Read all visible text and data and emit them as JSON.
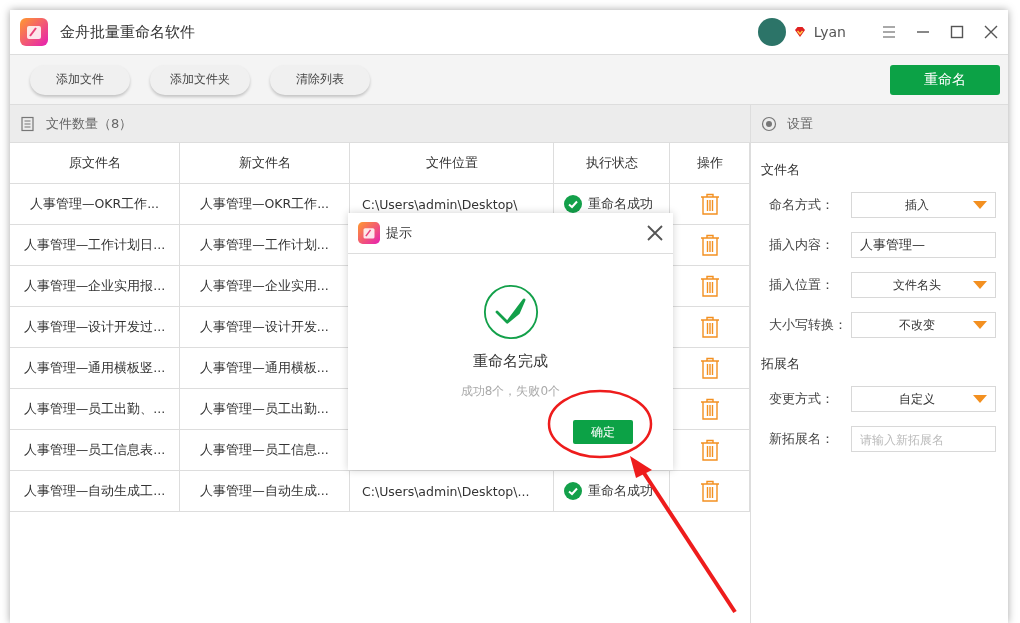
{
  "window": {
    "title": "金舟批量重命名软件",
    "user": "Lyan"
  },
  "toolbar": {
    "buttons": [
      "添加文件",
      "添加文件夹",
      "清除列表"
    ],
    "primary": "重命名"
  },
  "file_list": {
    "title": "文件数量（8）",
    "columns": [
      "原文件名",
      "新文件名",
      "文件位置",
      "执行状态",
      "操作"
    ],
    "rows": [
      {
        "original": "人事管理—OKR工作...",
        "renamed": "人事管理—OKR工作...",
        "location": "C:\\Users\\admin\\Desktop\\",
        "status": "重命名成功"
      },
      {
        "original": "人事管理—工作计划日...",
        "renamed": "人事管理—工作计划..."
      },
      {
        "original": "人事管理—企业实用报...",
        "renamed": "人事管理—企业实用..."
      },
      {
        "original": "人事管理—设计开发过...",
        "renamed": "人事管理—设计开发..."
      },
      {
        "original": "人事管理—通用横板竖...",
        "renamed": "人事管理—通用横板..."
      },
      {
        "original": "人事管理—员工出勤、...",
        "renamed": "人事管理—员工出勤..."
      },
      {
        "original": "人事管理—员工信息表...",
        "renamed": "人事管理—员工信息..."
      },
      {
        "original": "人事管理—自动生成工...",
        "renamed": "人事管理—自动生成...",
        "location": "C:\\Users\\admin\\Desktop\\...",
        "status": "重命名成功"
      }
    ]
  },
  "settings": {
    "title": "设置",
    "sections": [
      {
        "title": "文件名",
        "fields": [
          {
            "label": "命名方式：",
            "kind": "dropdown",
            "value": "插入"
          },
          {
            "label": "插入内容：",
            "kind": "input",
            "value": "人事管理—"
          },
          {
            "label": "插入位置：",
            "kind": "dropdown",
            "value": "文件名头"
          },
          {
            "label": "大小写转换：",
            "kind": "dropdown",
            "value": "不改变"
          }
        ]
      },
      {
        "title": "拓展名",
        "fields": [
          {
            "label": "变更方式：",
            "kind": "dropdown",
            "value": "自定义"
          },
          {
            "label": "新拓展名：",
            "kind": "input",
            "placeholder": "请输入新拓展名"
          }
        ]
      }
    ]
  },
  "dialog": {
    "title": "提示",
    "heading": "重命名完成",
    "summary": "成功8个，失败0个",
    "button": "确定"
  }
}
